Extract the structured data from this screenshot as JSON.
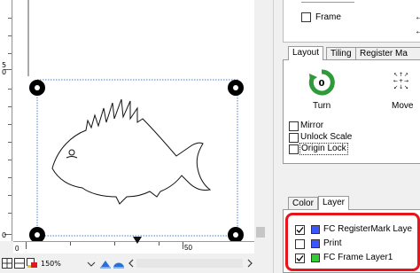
{
  "ruler_left": {
    "label_top": "5",
    "label_top_sub": "0",
    "label_bottom": "0"
  },
  "ruler_bottom": {
    "label_mid": "0",
    "label_right": "50"
  },
  "status": {
    "zoom": "150%"
  },
  "frame_option": {
    "label": "Frame",
    "checked": false
  },
  "tabs_top": [
    {
      "label": "Layout",
      "active": true
    },
    {
      "label": "Tiling",
      "active": false
    },
    {
      "label": "Register Ma",
      "active": false
    }
  ],
  "layout": {
    "turn_label": "Turn",
    "turn_value": "0",
    "move_label": "Move",
    "mirror_label": "Mirror",
    "unlock_scale_label": "Unlock Scale",
    "origin_lock_label": "Origin Lock"
  },
  "tabs_bottom": [
    {
      "label": "Color",
      "active": false
    },
    {
      "label": "Layer",
      "active": true
    }
  ],
  "layers": [
    {
      "name": "FC RegisterMark Laye",
      "checked": true,
      "color": "#3a57ff"
    },
    {
      "name": "Print",
      "checked": false,
      "color": "#3a57ff"
    },
    {
      "name": "FC Frame Layer1",
      "checked": true,
      "color": "#33cc33"
    }
  ],
  "colors": {
    "highlight": "#e8141b",
    "turn_green": "#2e9a3a",
    "guide_blue": "#4a7bd6"
  }
}
